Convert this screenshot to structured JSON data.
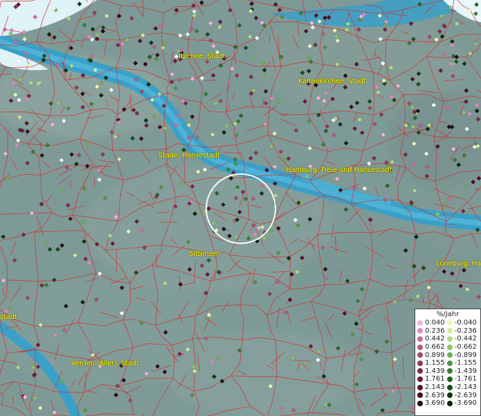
{
  "places": [
    {
      "name": "Itzehoe, Stadt"
    },
    {
      "name": "Kaltenkirchen, Stadt"
    },
    {
      "name": "Stade, Hansestadt"
    },
    {
      "name": "Hamburg, Freie und Hansestadt"
    },
    {
      "name": "Sittensen"
    },
    {
      "name": "Lüneburg, Ha"
    },
    {
      "name": "stadt"
    },
    {
      "name": "Verden (Aller), Stadt"
    }
  ],
  "legend": {
    "title": "%/Jahr",
    "positive": [
      {
        "label": "0.040",
        "color": "#f4b4e0"
      },
      {
        "label": "0.236",
        "color": "#e08cc0"
      },
      {
        "label": "0.442",
        "color": "#cc6c9c"
      },
      {
        "label": "0.662",
        "color": "#b85a84"
      },
      {
        "label": "0.899",
        "color": "#a4486c"
      },
      {
        "label": "1.155",
        "color": "#90385a"
      },
      {
        "label": "1.439",
        "color": "#7c2848"
      },
      {
        "label": "1.761",
        "color": "#681c38"
      },
      {
        "label": "2.143",
        "color": "#541228"
      },
      {
        "label": "2.639",
        "color": "#400a1c"
      },
      {
        "label": "3.690",
        "color": "#280410"
      }
    ],
    "negative": [
      {
        "label": "-0.040",
        "color": "#eef8b8"
      },
      {
        "label": "-0.236",
        "color": "#d2ec9c"
      },
      {
        "label": "-0.442",
        "color": "#b2dc84"
      },
      {
        "label": "-0.662",
        "color": "#90c46c"
      },
      {
        "label": "-0.899",
        "color": "#70ac56"
      },
      {
        "label": "-1.155",
        "color": "#549444"
      },
      {
        "label": "-1.439",
        "color": "#3c7c34"
      },
      {
        "label": "-1.761",
        "color": "#286428"
      },
      {
        "label": "-2.143",
        "color": "#184c1c"
      },
      {
        "label": "-2.639",
        "color": "#0c3410"
      },
      {
        "label": "-3.690",
        "color": "#042008"
      }
    ],
    "special_color": "#ffffff"
  },
  "colors": {
    "land": "#7e9a97",
    "water": "#3fa6cc",
    "boundary": "#d43030",
    "label": "#ffff00",
    "search_ring": "#ffffff"
  }
}
